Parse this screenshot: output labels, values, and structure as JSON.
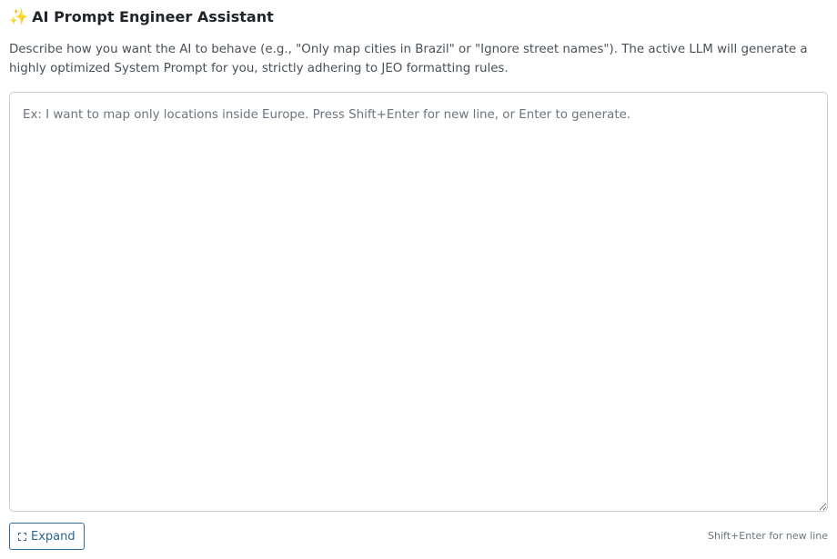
{
  "header": {
    "icon": "sparkles-icon",
    "icon_glyph": "✨",
    "title": "AI Prompt Engineer Assistant"
  },
  "description": "Describe how you want the AI to behave (e.g., \"Only map cities in Brazil\" or \"Ignore street names\"). The active LLM will generate a highly optimized System Prompt for you, strictly adhering to JEO formatting rules.",
  "prompt_input": {
    "value": "",
    "placeholder": "Ex: I want to map only locations inside Europe. Press Shift+Enter for new line, or Enter to generate."
  },
  "footer": {
    "expand_label": "Expand",
    "expand_icon": "expand-icon",
    "hint": "Shift+Enter for new line"
  },
  "colors": {
    "accent": "#2a6496",
    "text": "#212529",
    "muted": "#6c757d",
    "border": "#c8ccd0"
  }
}
